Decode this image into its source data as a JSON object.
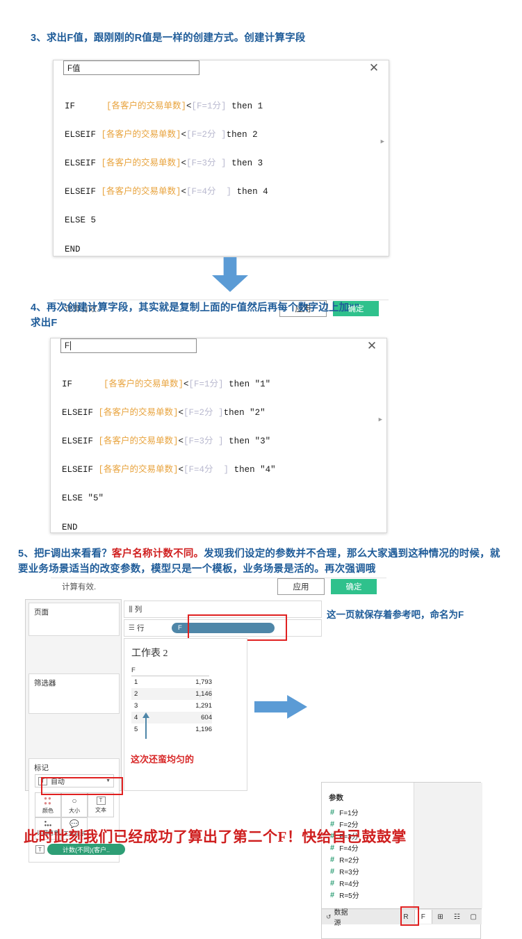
{
  "steps": {
    "step3": "3、求出F值，跟刚刚的R值是一样的创建方式。创建计算字段",
    "step4_line1": "4、再次创建计算字段，其实就是复制上面的F值然后再每个数字边上加“”",
    "step4_line2": "求出F",
    "step5_prefix": "5、把F调出来看看？",
    "step5_red": "客户名称计数不同。",
    "step5_rest": "发现我们设定的参数并不合理，那么大家遇到这种情况的时候，就要业务场景适当的改变参数，模型只是一个模板，业务场景是活的。再次强调哦"
  },
  "dialog1": {
    "name_value": "F值",
    "close_icon": "close-icon",
    "formula_lines": [
      {
        "kw": "IF      ",
        "field": "[各客户的交易单数]",
        "op": "<",
        "param": "[F=1分]",
        "tail": " then 1"
      },
      {
        "kw": "ELSEIF ",
        "field": "[各客户的交易单数]",
        "op": "<",
        "param": "[F=2分 ]",
        "tail": "then 2"
      },
      {
        "kw": "ELSEIF ",
        "field": "[各客户的交易单数]",
        "op": "<",
        "param": "[F=3分 ]",
        "tail": " then 3"
      },
      {
        "kw": "ELSEIF ",
        "field": "[各客户的交易单数]",
        "op": "<",
        "param": "[F=4分  ]",
        "tail": " then 4"
      },
      {
        "kw": "ELSE 5",
        "field": "",
        "op": "",
        "param": "",
        "tail": ""
      },
      {
        "kw": "END",
        "field": "",
        "op": "",
        "param": "",
        "tail": ""
      }
    ],
    "status": "计算有效.",
    "apply_label": "应用",
    "ok_label": "确定"
  },
  "dialog2": {
    "name_value": "F",
    "close_icon": "close-icon",
    "formula_lines": [
      {
        "kw": "IF      ",
        "field": "[各客户的交易单数]",
        "op": "<",
        "param": "[F=1分]",
        "tail": " then \"1\""
      },
      {
        "kw": "ELSEIF ",
        "field": "[各客户的交易单数]",
        "op": "<",
        "param": "[F=2分 ]",
        "tail": "then \"2\""
      },
      {
        "kw": "ELSEIF ",
        "field": "[各客户的交易单数]",
        "op": "<",
        "param": "[F=3分 ]",
        "tail": " then \"3\""
      },
      {
        "kw": "ELSEIF ",
        "field": "[各客户的交易单数]",
        "op": "<",
        "param": "[F=4分  ]",
        "tail": " then \"4\""
      },
      {
        "kw": "ELSE \"5\"",
        "field": "",
        "op": "",
        "param": "",
        "tail": ""
      },
      {
        "kw": "END",
        "field": "",
        "op": "",
        "param": "",
        "tail": ""
      }
    ],
    "status": "计算有效.",
    "apply_label": "应用",
    "ok_label": "确定"
  },
  "tableau": {
    "pages_label": "页面",
    "filters_label": "筛选器",
    "marks_label": "标记",
    "marks_type": "自动",
    "marks_buttons": [
      {
        "label": "颜色",
        "icon": "color-palette-icon"
      },
      {
        "label": "大小",
        "icon": "size-icon"
      },
      {
        "label": "文本",
        "icon": "text-icon"
      },
      {
        "label": "详细信息",
        "icon": "detail-icon"
      },
      {
        "label": "工具提示",
        "icon": "tooltip-icon"
      }
    ],
    "marks_pill": "计数(不同)(客户..",
    "columns_label": "列",
    "rows_label": "行",
    "rows_pill": "F",
    "worksheet_title": "工作表 2",
    "table_header": "F",
    "table_rows": [
      {
        "k": "1",
        "v": "1,793"
      },
      {
        "k": "2",
        "v": "1,146"
      },
      {
        "k": "3",
        "v": "1,291"
      },
      {
        "k": "4",
        "v": "604"
      },
      {
        "k": "5",
        "v": "1,196"
      }
    ],
    "annotation": "这次还蛮均匀的"
  },
  "params_panel": {
    "note": "这一页就保存着参考吧，命名为F",
    "header": "参数",
    "items": [
      "F=1分",
      "F=2分",
      "F=3分",
      "F=4分",
      "R=2分",
      "R=3分",
      "R=4分",
      "R=5分"
    ],
    "datasource_label": "数据源",
    "tabs": [
      "R",
      "F"
    ],
    "active_tab": "F",
    "new_sheet_icons": [
      "new-worksheet-icon",
      "new-dashboard-icon",
      "new-story-icon"
    ]
  },
  "footer_text": "此时此刻我们已经成功了算出了第二个F！快给自己鼓鼓掌",
  "colors": {
    "heading_blue": "#1f5c99",
    "red": "#d02020",
    "green_ok": "#2fc18c",
    "arrow_blue": "#5b9bd5",
    "pill_blue": "#4e86a8",
    "pill_green": "#2e9e75",
    "field_orange": "#e8a33d",
    "param_gray": "#b9b9cf"
  }
}
